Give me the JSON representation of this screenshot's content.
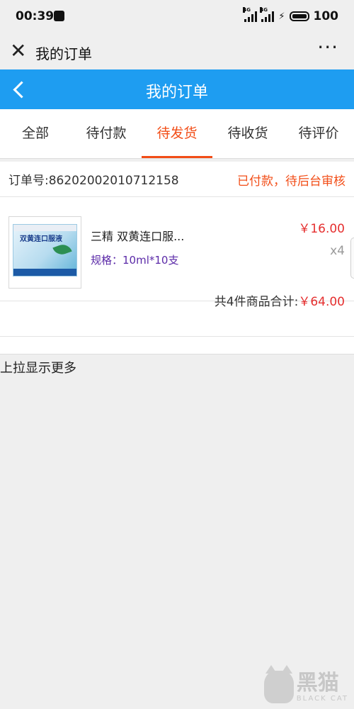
{
  "status_bar": {
    "time": "00:39",
    "network_1": "4G",
    "network_2": "4G",
    "battery": "100"
  },
  "webview_header": {
    "title": "我的订单",
    "close_icon": "close-icon",
    "more_icon": "more-icon"
  },
  "app_bar": {
    "title": "我的订单",
    "back_icon": "chevron-left-icon",
    "bg_color": "#1e9df1"
  },
  "tabs": [
    {
      "label": "全部",
      "active": false
    },
    {
      "label": "待付款",
      "active": false
    },
    {
      "label": "待发货",
      "active": true
    },
    {
      "label": "待收货",
      "active": false
    },
    {
      "label": "待评价",
      "active": false
    }
  ],
  "accent_color": "#f24d17",
  "order": {
    "order_no_label": "订单号:",
    "order_no": "86202002010712158",
    "status": "已付款，待后台审核",
    "item": {
      "name": "三精 双黄连口服...",
      "spec": "规格：10ml*10支",
      "price": "￥16.00",
      "qty": "x4",
      "image_label": "双黄连口服液"
    },
    "total_prefix": "共4件商品合计:",
    "total_amount": "￥64.00"
  },
  "footer": {
    "load_more": "上拉显示更多"
  },
  "watermark": {
    "cn": "黑猫",
    "en": "BLACK CAT"
  }
}
